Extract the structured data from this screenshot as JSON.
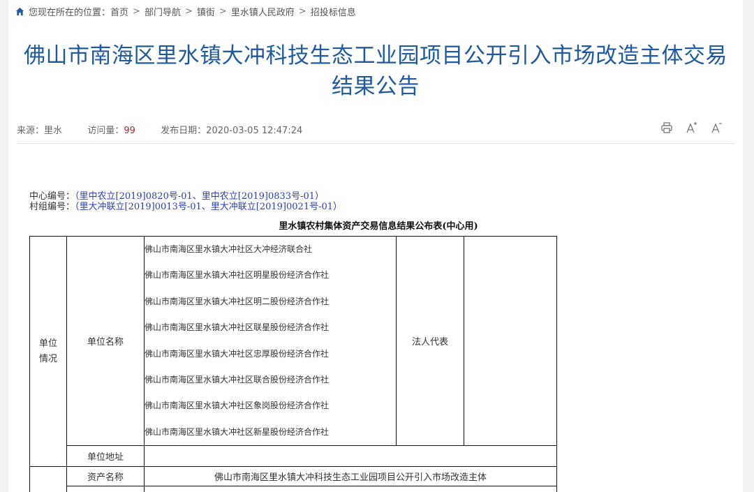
{
  "breadcrumb": {
    "prefix": "您现在所在的位置：",
    "items": [
      "首页",
      "部门导航",
      "镇街",
      "里水镇人民政府",
      "招投标信息"
    ],
    "separator": ">"
  },
  "article": {
    "title_line1": "佛山市南海区里水镇大冲科技生态工业园项目公开引入市场改造主体交易",
    "title_line2": "结果公告",
    "source_label": "来源：",
    "source_value": "里水",
    "visits_label": "访问量：",
    "visits_value": "99",
    "date_label": "发布日期：",
    "date_value": "2020-03-05 12:47:24"
  },
  "tools": {
    "print_icon": "printer-icon",
    "font_increase_icon": "font-increase-icon",
    "font_decrease_icon": "font-decrease-icon"
  },
  "codes": {
    "center_label": "中心编号：",
    "center_value": "里中农立[2019]0820号-01、里中农立[2019]0833号-01",
    "village_label": "村组编号：",
    "village_value": "里大冲联立[2019]0013号-01、里大冲联立[2019]0021号-01"
  },
  "table": {
    "title": "里水镇农村集体资产交易信息结果公布表(中心用)",
    "unit_section_line1": "单位",
    "unit_section_line2": "情况",
    "unit_name_label": "单位名称",
    "unit_names": [
      "佛山市南海区里水镇大冲社区大冲经济联合社",
      "佛山市南海区里水镇大冲社区明星股份经济合作社",
      "佛山市南海区里水镇大冲社区明二股份经济合作社",
      "佛山市南海区里水镇大冲社区联星股份经济合作社",
      "佛山市南海区里水镇大冲社区忠厚股份经济合作社",
      "佛山市南海区里水镇大冲社区联合股份经济合作社",
      "佛山市南海区里水镇大冲社区象岗股份经济合作社",
      "佛山市南海区里水镇大冲社区新星股份经济合作社"
    ],
    "legal_rep_label": "法人代表",
    "unit_address_label": "单位地址",
    "asset_name_label": "资产名称",
    "asset_name_value": "佛山市南海区里水镇大冲科技生态工业园项目公开引入市场改造主体"
  },
  "colors": {
    "title": "#1f5a9c",
    "visits": "#a52a2a",
    "code_value": "#2b3fb0"
  }
}
